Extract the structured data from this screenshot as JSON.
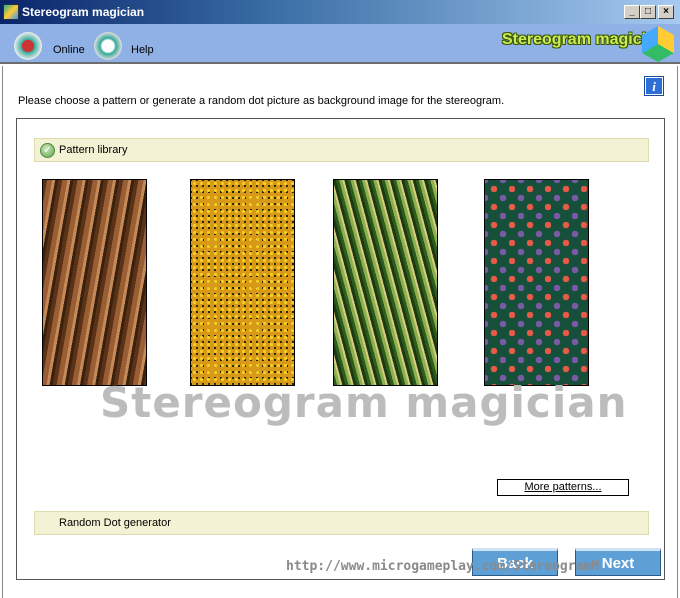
{
  "window": {
    "title": "Stereogram magician",
    "minimize": "_",
    "maximize": "□",
    "close": "×"
  },
  "toolbar": {
    "online": "Online",
    "help": "Help",
    "brand": "Stereogram magician"
  },
  "main": {
    "instruction": "Please choose a pattern or generate a random dot picture as background image for the stereogram.",
    "info": "i"
  },
  "sections": {
    "pattern_library": "Pattern library",
    "random_dot": "Random Dot generator"
  },
  "patterns": [
    {
      "name": "bark"
    },
    {
      "name": "yellow-flowers"
    },
    {
      "name": "rice"
    },
    {
      "name": "leaves"
    }
  ],
  "more_patterns": "More patterns...",
  "watermark": "Stereogram magician",
  "url": "http://www.microgameplay.com/StereogramM",
  "buttons": {
    "back": "Back",
    "next": "Next"
  }
}
